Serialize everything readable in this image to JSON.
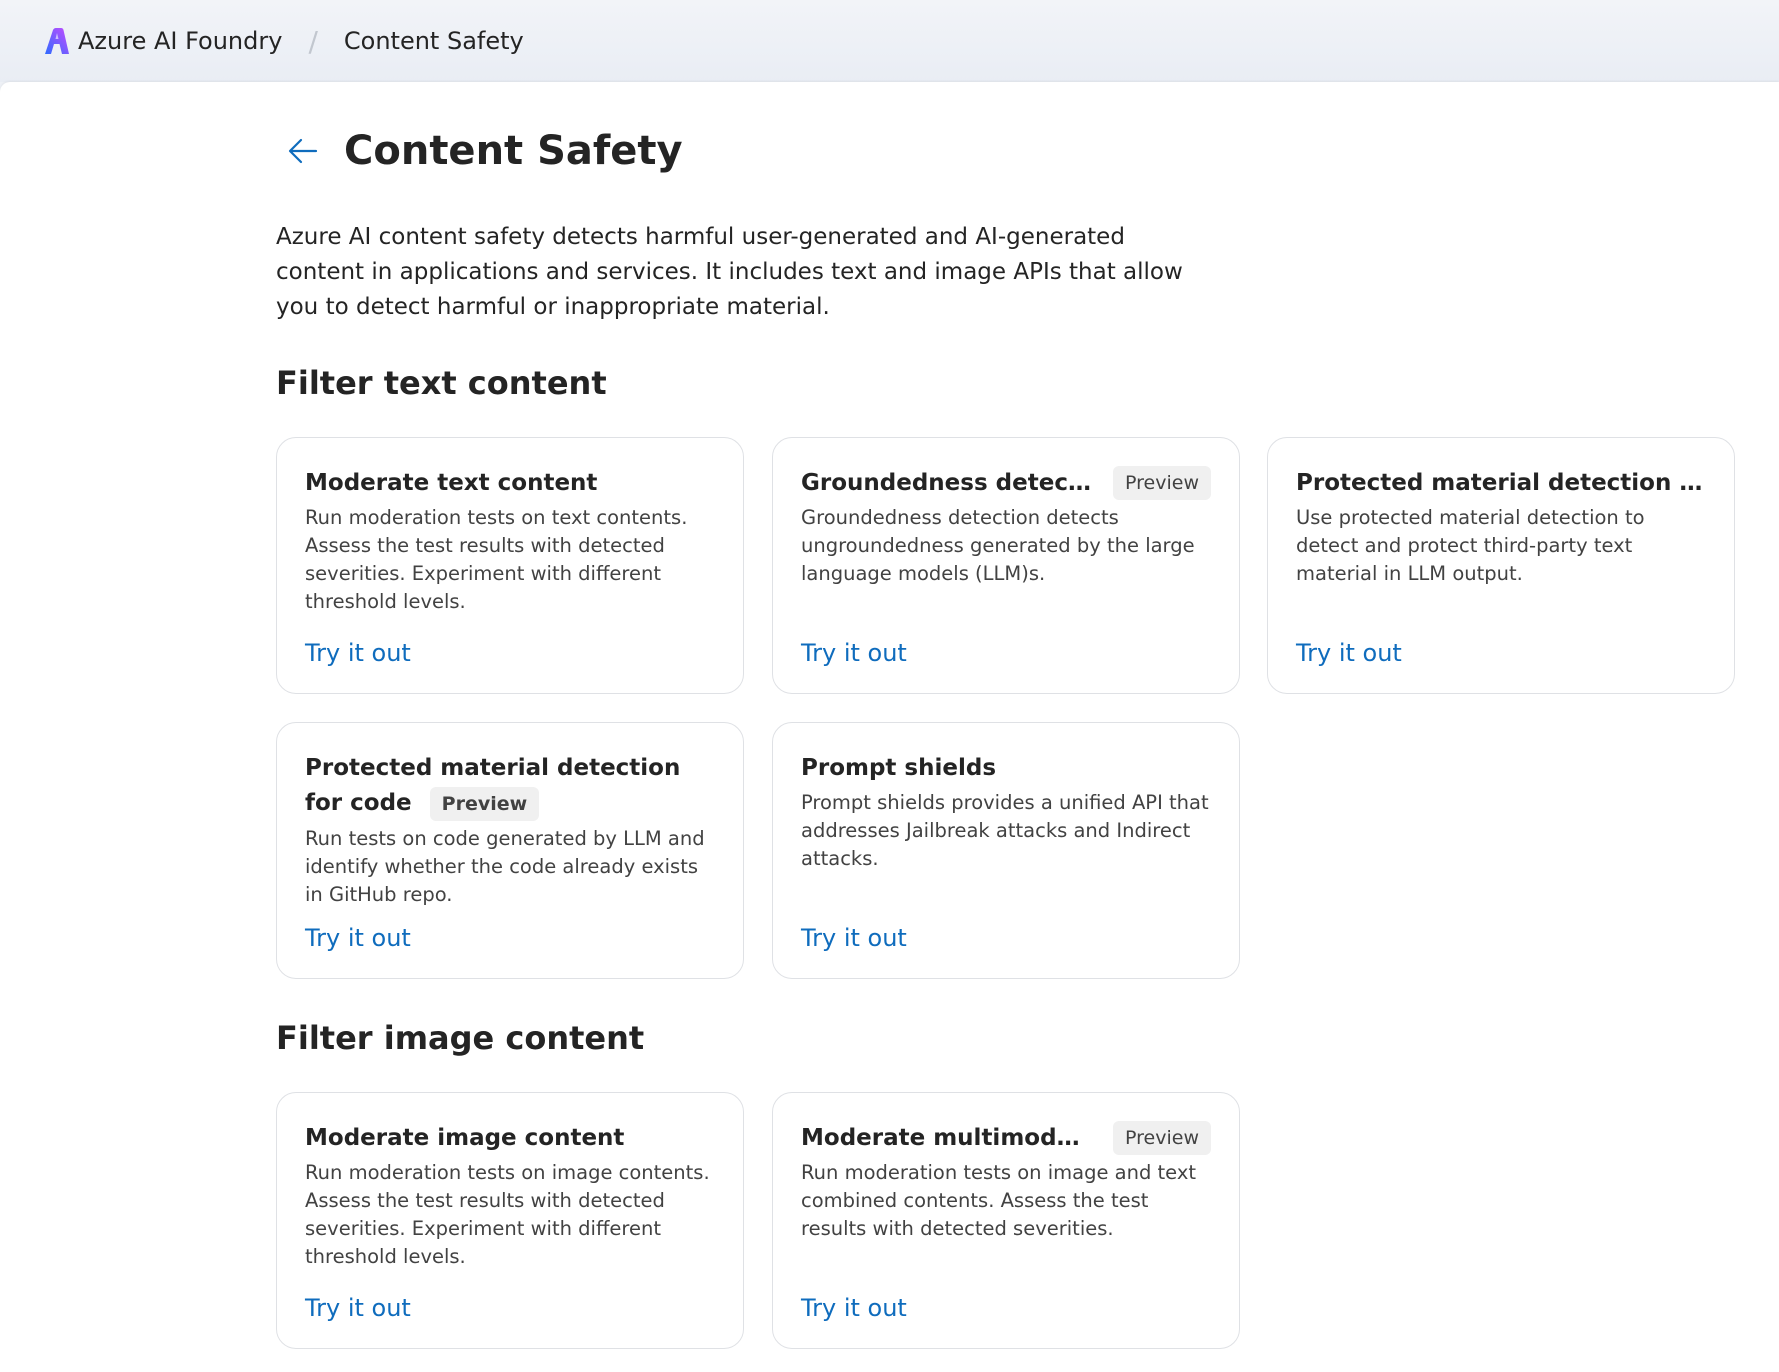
{
  "breadcrumb": {
    "app_name": "Azure AI Foundry",
    "separator": "/",
    "current": "Content Safety"
  },
  "page": {
    "title": "Content Safety",
    "description": "Azure AI content safety detects harmful user-generated and AI-generated content in applications and services. It includes text and image APIs that allow you to detect harmful or inappropriate material."
  },
  "sections": [
    {
      "title": "Filter text content",
      "cards": [
        {
          "title": "Moderate text content",
          "badge": "",
          "description": "Run moderation tests on text contents. Assess the test results with detected severities. Experiment with different threshold levels.",
          "link": "Try it out"
        },
        {
          "title": "Groundedness detection",
          "badge": "Preview",
          "description": "Groundedness detection detects ungroundedness generated by the large language models (LLM)s.",
          "link": "Try it out"
        },
        {
          "title": "Protected material detection for text",
          "badge": "",
          "description": "Use protected material detection to detect and protect third-party text material in LLM output.",
          "link": "Try it out"
        },
        {
          "title": "Protected material detection for code",
          "badge": "Preview",
          "description": "Run tests on code generated by LLM and identify whether the code already exists in GitHub repo.",
          "link": "Try it out"
        },
        {
          "title": "Prompt shields",
          "badge": "",
          "description": "Prompt shields provides a unified API that addresses Jailbreak attacks and Indirect attacks.",
          "link": "Try it out"
        }
      ]
    },
    {
      "title": "Filter image content",
      "cards": [
        {
          "title": "Moderate image content",
          "badge": "",
          "description": "Run moderation tests on image contents. Assess the test results with detected severities. Experiment with different threshold levels.",
          "link": "Try it out"
        },
        {
          "title": "Moderate multimodal c...",
          "badge": "Preview",
          "description": "Run moderation tests on image and text combined contents. Assess the test results with detected severities.",
          "link": "Try it out"
        }
      ]
    }
  ],
  "colors": {
    "link": "#0f6cbd",
    "logo_start": "#2f6bff",
    "logo_end": "#c64bff"
  },
  "icons": {
    "logo": "azure-ai-foundry-logo-icon",
    "back": "arrow-left-icon"
  }
}
